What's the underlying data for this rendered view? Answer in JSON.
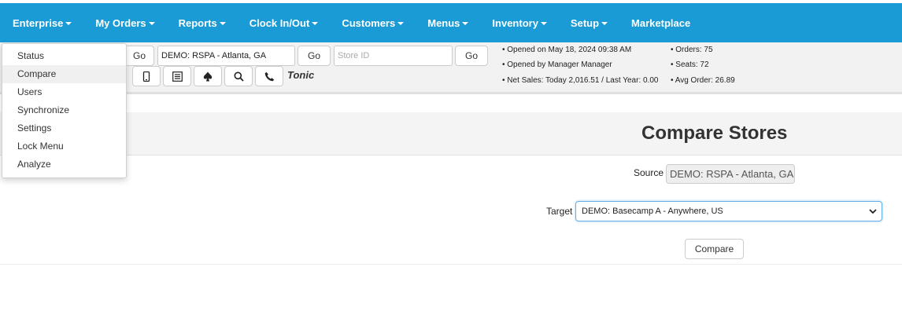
{
  "nav": {
    "items": [
      {
        "label": "Enterprise",
        "caret": true
      },
      {
        "label": "My Orders",
        "caret": true
      },
      {
        "label": "Reports",
        "caret": true
      },
      {
        "label": "Clock In/Out",
        "caret": true
      },
      {
        "label": "Customers",
        "caret": true
      },
      {
        "label": "Menus",
        "caret": true
      },
      {
        "label": "Inventory",
        "caret": true
      },
      {
        "label": "Setup",
        "caret": true
      },
      {
        "label": "Marketplace",
        "caret": false
      }
    ],
    "color": "#1b9bd6"
  },
  "dropdown": {
    "items": [
      "Status",
      "Compare",
      "Users",
      "Synchronize",
      "Settings",
      "Lock Menu",
      "Analyze"
    ],
    "active": "Compare"
  },
  "toolbar": {
    "go1": "Go",
    "store_value": "DEMO: RSPA - Atlanta, GA",
    "go2": "Go",
    "store_id_placeholder": "Store ID",
    "go3": "Go",
    "icons": [
      "mobile-icon",
      "list-icon",
      "spade-icon",
      "search-icon",
      "phone-icon"
    ],
    "tonic": "Tonic"
  },
  "stats": {
    "opened_on": "• Opened on May 18, 2024 09:38 AM",
    "opened_by": "• Opened by Manager Manager",
    "net_sales": "• Net Sales: Today 2,016.51 / Last Year: 0.00",
    "orders": "• Orders: 75",
    "seats": "• Seats: 72",
    "avg_order": "• Avg Order: 26.89"
  },
  "page": {
    "title": "Compare Stores",
    "source_label": "Source",
    "source_value": "DEMO: RSPA - Atlanta, GA",
    "target_label": "Target",
    "target_value": "DEMO: Basecamp A - Anywhere, US",
    "compare_button": "Compare"
  }
}
